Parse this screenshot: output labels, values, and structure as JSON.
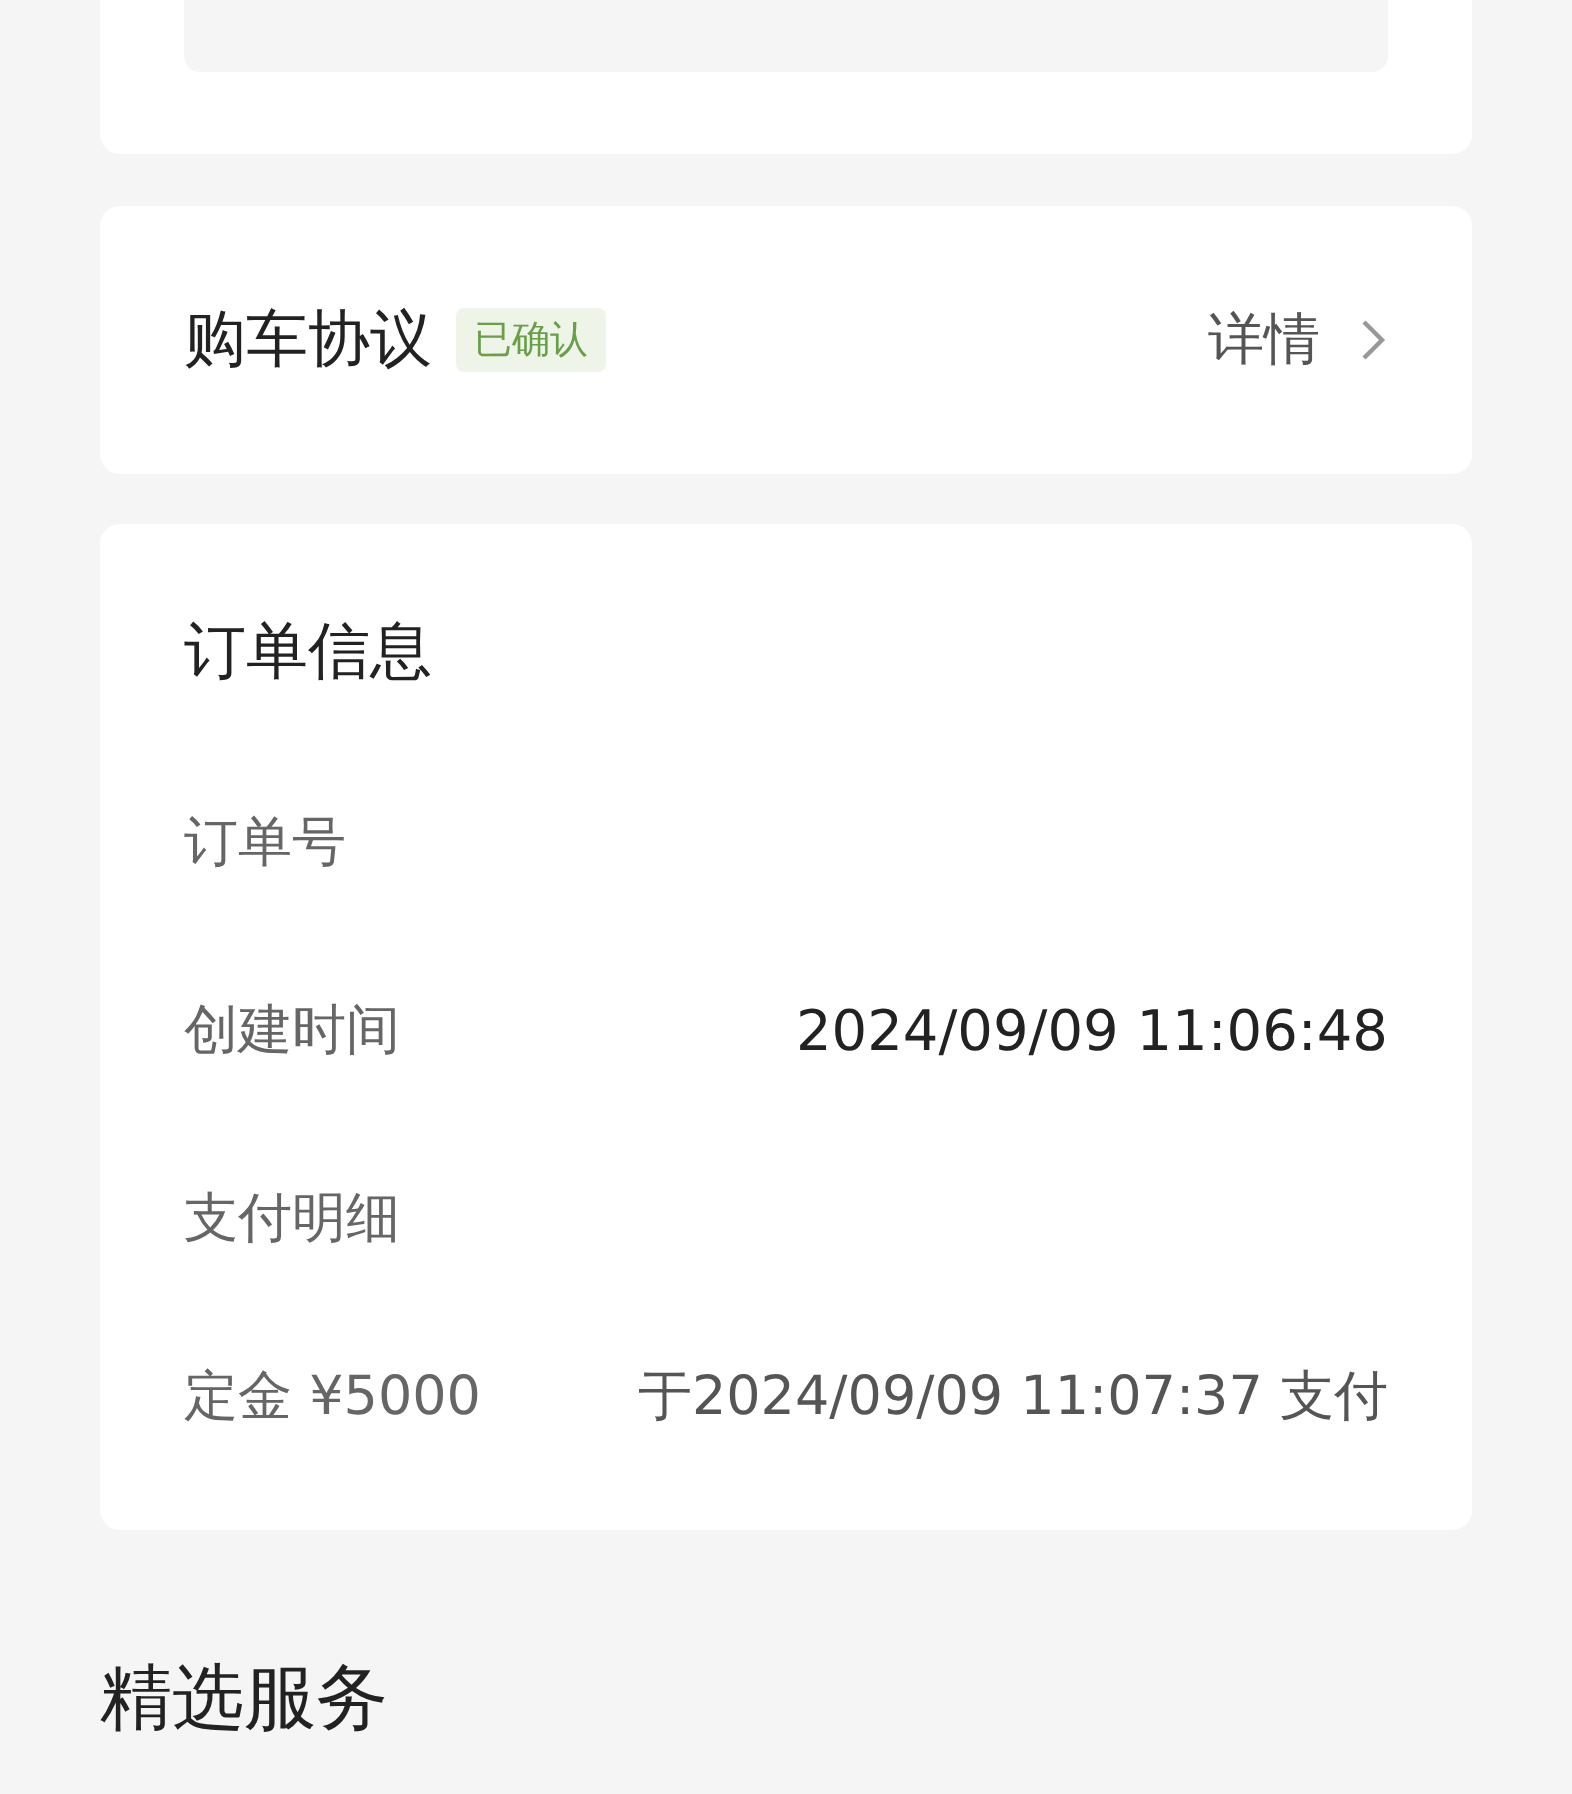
{
  "agreement": {
    "title": "购车协议",
    "badge": "已确认",
    "link": "详情"
  },
  "order_info": {
    "title": "订单信息",
    "rows": [
      {
        "kind": "pair",
        "label": "订单号"
      },
      {
        "kind": "pair",
        "label": "创建时间",
        "value": "2024/09/09 11:06:48"
      },
      {
        "kind": "heading",
        "label": "支付明细"
      },
      {
        "kind": "payment",
        "label": "定金 ¥5000",
        "value": "于2024/09/09 11:07:37 支付"
      }
    ]
  },
  "services": {
    "title": "精选服务"
  }
}
